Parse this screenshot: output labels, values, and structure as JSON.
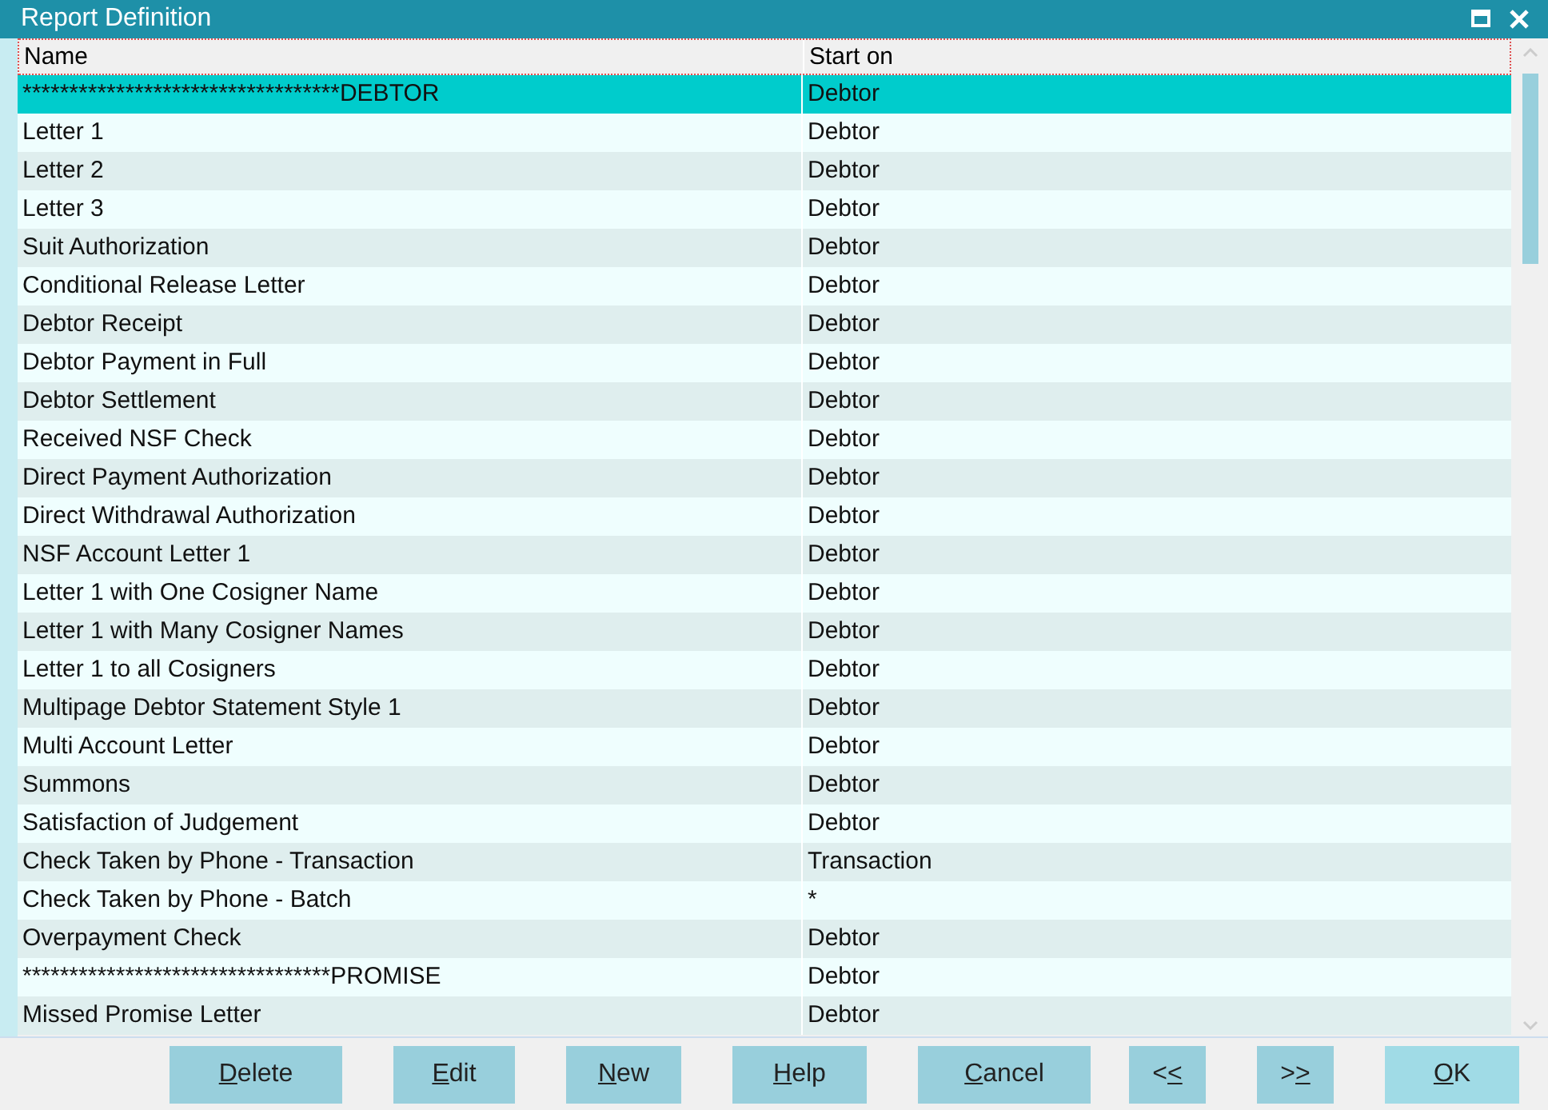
{
  "window": {
    "title": "Report Definition"
  },
  "table": {
    "columns": [
      "Name",
      "Start on"
    ],
    "rows": [
      {
        "name": "**********************************DEBTOR",
        "start_on": "Debtor",
        "selected": true
      },
      {
        "name": "Letter 1",
        "start_on": "Debtor",
        "selected": false
      },
      {
        "name": "Letter 2",
        "start_on": "Debtor",
        "selected": false
      },
      {
        "name": "Letter 3",
        "start_on": "Debtor",
        "selected": false
      },
      {
        "name": "Suit Authorization",
        "start_on": "Debtor",
        "selected": false
      },
      {
        "name": "Conditional Release Letter",
        "start_on": "Debtor",
        "selected": false
      },
      {
        "name": "Debtor Receipt",
        "start_on": "Debtor",
        "selected": false
      },
      {
        "name": "Debtor Payment in Full",
        "start_on": "Debtor",
        "selected": false
      },
      {
        "name": "Debtor Settlement",
        "start_on": "Debtor",
        "selected": false
      },
      {
        "name": "Received NSF Check",
        "start_on": "Debtor",
        "selected": false
      },
      {
        "name": "Direct Payment Authorization",
        "start_on": "Debtor",
        "selected": false
      },
      {
        "name": "Direct Withdrawal Authorization",
        "start_on": "Debtor",
        "selected": false
      },
      {
        "name": "NSF Account Letter 1",
        "start_on": "Debtor",
        "selected": false
      },
      {
        "name": "Letter 1 with One Cosigner Name",
        "start_on": "Debtor",
        "selected": false
      },
      {
        "name": "Letter 1 with Many Cosigner Names",
        "start_on": "Debtor",
        "selected": false
      },
      {
        "name": "Letter 1 to all Cosigners",
        "start_on": "Debtor",
        "selected": false
      },
      {
        "name": "Multipage Debtor Statement Style 1",
        "start_on": "Debtor",
        "selected": false
      },
      {
        "name": "Multi Account Letter",
        "start_on": "Debtor",
        "selected": false
      },
      {
        "name": "Summons",
        "start_on": "Debtor",
        "selected": false
      },
      {
        "name": "Satisfaction of Judgement",
        "start_on": "Debtor",
        "selected": false
      },
      {
        "name": "Check Taken by Phone - Transaction",
        "start_on": "Transaction",
        "selected": false
      },
      {
        "name": "Check Taken by Phone - Batch",
        "start_on": "*",
        "selected": false
      },
      {
        "name": "Overpayment Check",
        "start_on": "Debtor",
        "selected": false
      },
      {
        "name": "*********************************PROMISE",
        "start_on": "Debtor",
        "selected": false
      },
      {
        "name": "Missed Promise Letter",
        "start_on": "Debtor",
        "selected": false
      }
    ]
  },
  "buttons": [
    {
      "accel": "D",
      "after": "elete"
    },
    {
      "accel": "E",
      "after": "dit"
    },
    {
      "accel": "N",
      "after": "ew"
    },
    {
      "accel": "H",
      "after": "elp"
    },
    {
      "accel": "C",
      "after": "ancel"
    },
    {
      "before": "<",
      "accel": "<"
    },
    {
      "before": ">",
      "accel": ">"
    },
    {
      "accel": "O",
      "after": "K"
    }
  ]
}
